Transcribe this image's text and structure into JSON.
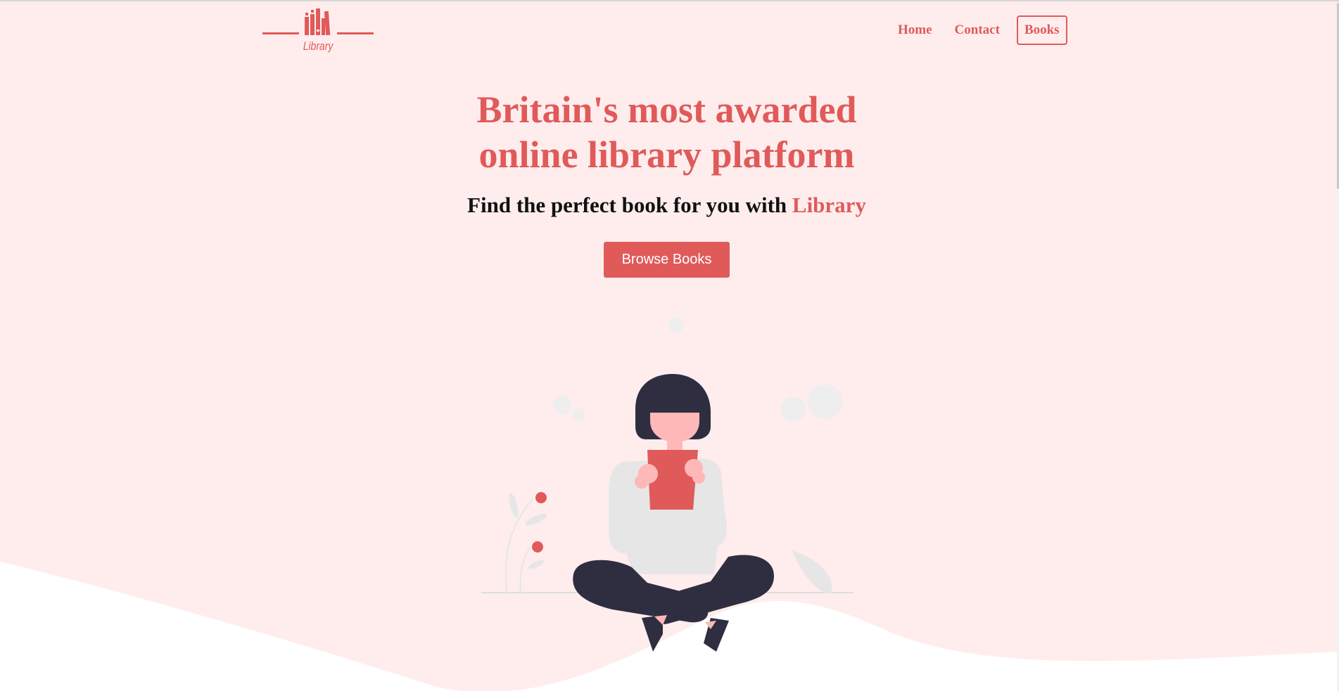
{
  "header": {
    "logo_text": "Library",
    "nav": {
      "home": "Home",
      "contact": "Contact",
      "books": "Books"
    }
  },
  "hero": {
    "title_line1": "Britain's most awarded",
    "title_line2": "online library platform",
    "subtitle_prefix": "Find the perfect book for you with ",
    "subtitle_brand": "Library",
    "cta_label": "Browse Books"
  },
  "colors": {
    "accent": "#e05a5a",
    "background": "#ffeded",
    "figure_dark": "#2f2e41",
    "skin": "#ffb8b8",
    "light_gray": "#e6e6e6"
  }
}
